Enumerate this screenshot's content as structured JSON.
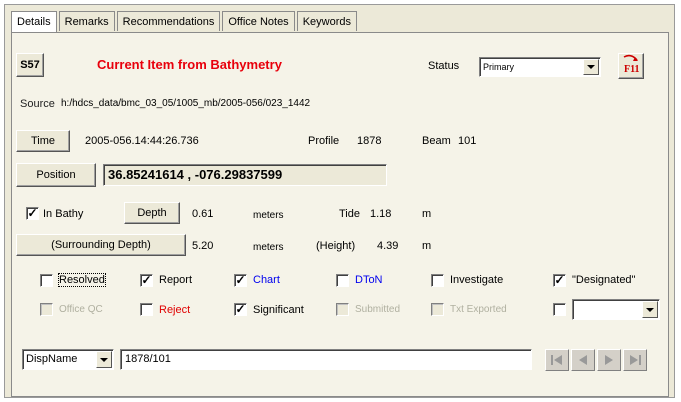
{
  "tabs": [
    "Details",
    "Remarks",
    "Recommendations",
    "Office Notes",
    "Keywords"
  ],
  "header": {
    "s57_label": "S57",
    "title": "Current Item from Bathymetry",
    "status_label": "Status",
    "status_value": "Primary"
  },
  "source": {
    "label": "Source",
    "value": "h:/hdcs_data/bmc_03_05/1005_mb/2005-056/023_1442"
  },
  "time": {
    "button": "Time",
    "value": "2005-056.14:44:26.736",
    "profile_label": "Profile",
    "profile_value": "1878",
    "beam_label": "Beam",
    "beam_value": "101"
  },
  "position": {
    "button": "Position",
    "value": "36.85241614 , -076.29837599"
  },
  "depth_row": {
    "in_bathy_label": "In Bathy",
    "depth_button": "Depth",
    "depth_value": "0.61",
    "depth_unit": "meters",
    "tide_label": "Tide",
    "tide_value": "1.18",
    "tide_unit": "m"
  },
  "surround_row": {
    "button": "(Surrounding Depth)",
    "value": "5.20",
    "unit": "meters",
    "height_label": "(Height)",
    "height_value": "4.39",
    "height_unit": "m"
  },
  "checks_row1": [
    {
      "label": "Resolved",
      "checked": false
    },
    {
      "label": "Report",
      "checked": true
    },
    {
      "label": "Chart",
      "checked": true
    },
    {
      "label": "DToN",
      "checked": false
    },
    {
      "label": "Investigate",
      "checked": false
    },
    {
      "label": "\"Designated\"",
      "checked": true
    }
  ],
  "checks_row2": [
    {
      "label": "Office QC",
      "checked": false
    },
    {
      "label": "Reject",
      "checked": false
    },
    {
      "label": "Significant",
      "checked": true
    },
    {
      "label": "Submitted",
      "checked": false
    },
    {
      "label": "Txt Exported",
      "checked": false
    }
  ],
  "bottom": {
    "dispname_value": "DispName",
    "text_value": "1878/101"
  },
  "colors": {
    "title_red": "#e8000c",
    "chart_blue": "#0000ee",
    "reject_red": "#e00000"
  },
  "check_glyph": "✓"
}
